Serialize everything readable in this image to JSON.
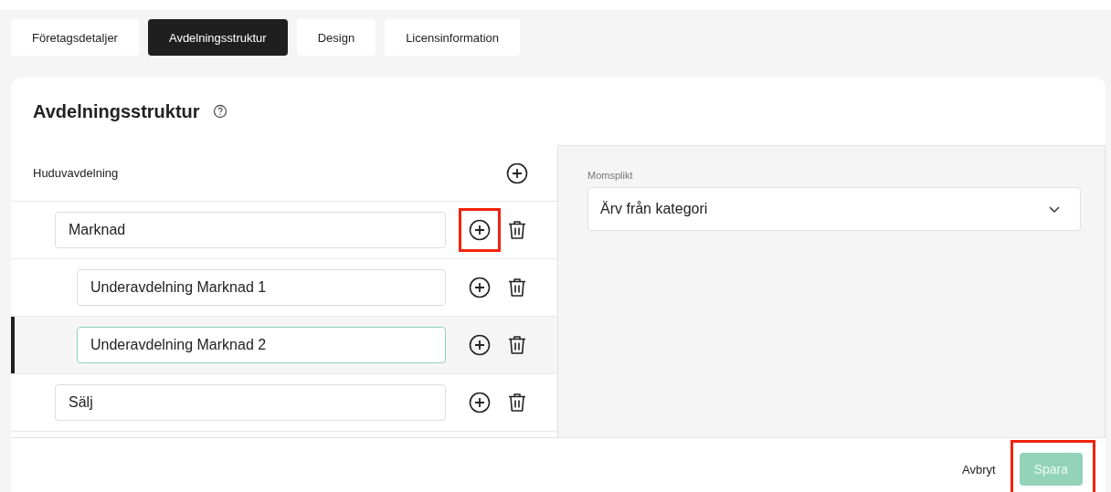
{
  "tabs": [
    {
      "label": "Företagsdetaljer",
      "selected": false
    },
    {
      "label": "Avdelningsstruktur",
      "selected": true
    },
    {
      "label": "Design",
      "selected": false
    },
    {
      "label": "Licensinformation",
      "selected": false
    }
  ],
  "section": {
    "title": "Avdelningsstruktur"
  },
  "tree": {
    "label": "Huduvavdelning",
    "children": [
      {
        "value": "Marknad",
        "selected": false,
        "highlighted": true,
        "children": [
          {
            "value": "Underavdelning Marknad 1",
            "selected": false,
            "highlighted": false
          },
          {
            "value": "Underavdelning Marknad 2",
            "selected": true,
            "highlighted": false
          }
        ]
      },
      {
        "value": "Sälj",
        "selected": false,
        "highlighted": false
      }
    ]
  },
  "details": {
    "label": "Momsplikt",
    "value": "Ärv från kategori"
  },
  "footer": {
    "cancel": "Avbryt",
    "save": {
      "label": "Spara",
      "disabled": true,
      "highlighted": true
    }
  }
}
